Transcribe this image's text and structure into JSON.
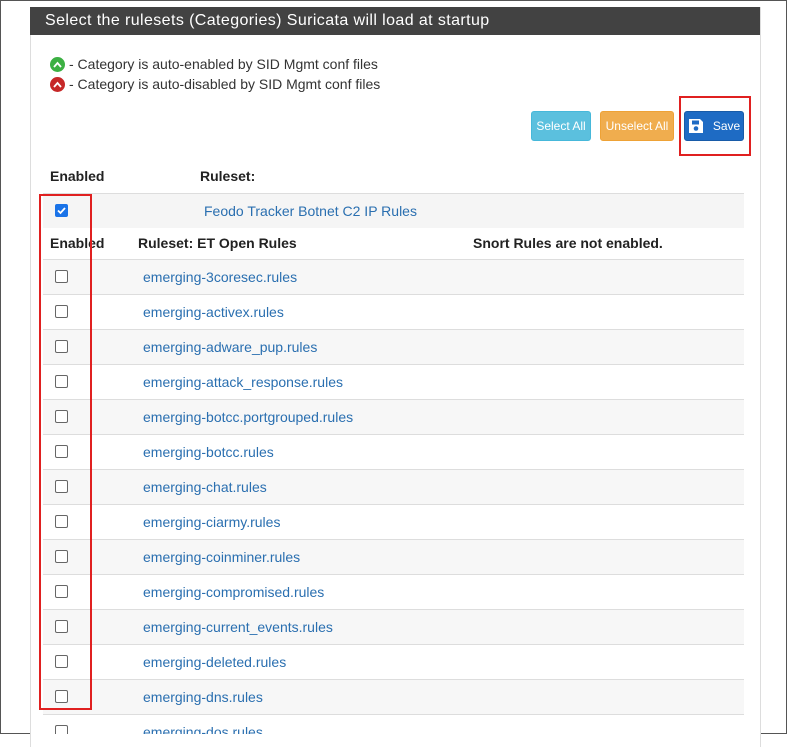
{
  "panel": {
    "title": "Select the rulesets (Categories) Suricata will load at startup"
  },
  "legend": {
    "enabled_text": "- Category is auto-enabled by SID Mgmt conf files",
    "disabled_text": "- Category is auto-disabled by SID Mgmt conf files",
    "enabled_color": "#3cb043",
    "disabled_color": "#c62828",
    "enabled_icon": "chevron-up-icon",
    "disabled_icon": "chevron-up-icon"
  },
  "buttons": {
    "select_all": "Select All",
    "unselect_all": "Unselect All",
    "save": "Save",
    "save_icon": "floppy-disk-icon"
  },
  "feodo_section": {
    "enabled_header": "Enabled",
    "ruleset_header": "Ruleset:",
    "rule": {
      "name": "Feodo Tracker Botnet C2 IP Rules",
      "checked": true
    }
  },
  "et_section": {
    "enabled_header": "Enabled",
    "ruleset_header": "Ruleset: ET Open Rules",
    "snort_note": "Snort Rules are not enabled.",
    "rules": [
      {
        "name": "emerging-3coresec.rules",
        "checked": false
      },
      {
        "name": "emerging-activex.rules",
        "checked": false
      },
      {
        "name": "emerging-adware_pup.rules",
        "checked": false
      },
      {
        "name": "emerging-attack_response.rules",
        "checked": false
      },
      {
        "name": "emerging-botcc.portgrouped.rules",
        "checked": false
      },
      {
        "name": "emerging-botcc.rules",
        "checked": false
      },
      {
        "name": "emerging-chat.rules",
        "checked": false
      },
      {
        "name": "emerging-ciarmy.rules",
        "checked": false
      },
      {
        "name": "emerging-coinminer.rules",
        "checked": false
      },
      {
        "name": "emerging-compromised.rules",
        "checked": false
      },
      {
        "name": "emerging-current_events.rules",
        "checked": false
      },
      {
        "name": "emerging-deleted.rules",
        "checked": false
      },
      {
        "name": "emerging-dns.rules",
        "checked": false
      },
      {
        "name": "emerging-dos.rules",
        "checked": false
      }
    ]
  }
}
